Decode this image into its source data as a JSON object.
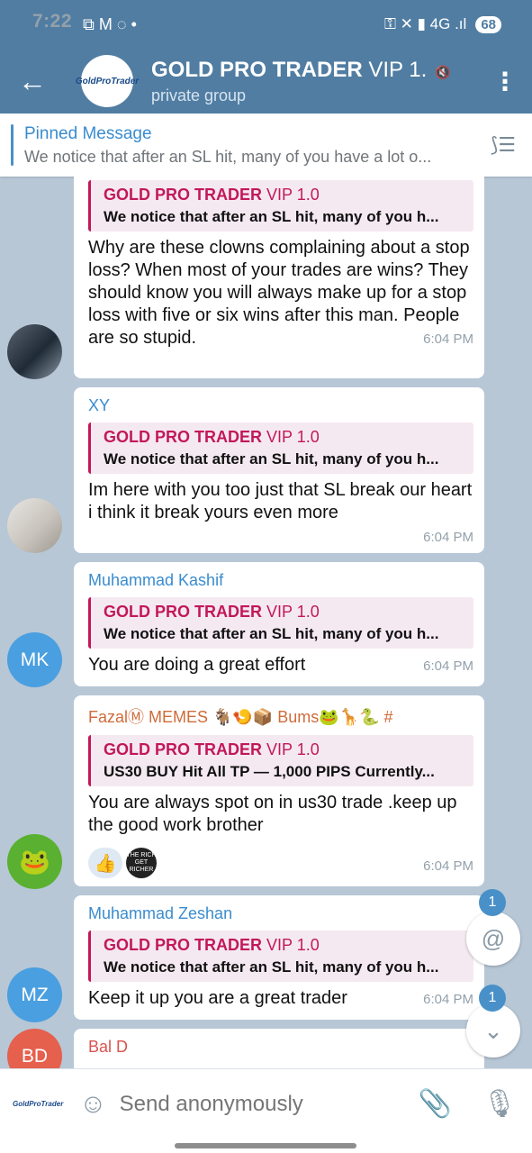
{
  "status": {
    "time": "7:22",
    "battery": "68",
    "left_icons": "⧉ M ◌ •",
    "right_icons": "⚿ ✕ ▮ 4G .ıl"
  },
  "header": {
    "title_bold": "GOLD PRO TRADER",
    "title_rest": " VIP 1.",
    "subtitle": "private group",
    "avatar_text": "GoldProTrader",
    "back_icon": "←",
    "menu_icon": "⋮"
  },
  "pinned": {
    "title": "Pinned Message",
    "body": "We notice that after an SL hit, many of you have a lot o..."
  },
  "messages": [
    {
      "author": "",
      "reply_title_bold": "GOLD PRO TRADER",
      "reply_title_rest": " VIP 1.0",
      "reply_body": "We notice that after an SL hit, many of you h...",
      "text": "Why are these clowns complaining about a stop loss? When most of your trades are wins? They should know you will always make up for a stop loss with five or six wins after this man. People are so stupid.",
      "time": "6:04 PM"
    },
    {
      "author": "XY",
      "author_color": "#3a8ccf",
      "reply_title_bold": "GOLD PRO TRADER",
      "reply_title_rest": " VIP 1.0",
      "reply_body": "We notice that after an SL hit, many of you h...",
      "text": "Im here with you too just that SL break our heart i think it break yours even more",
      "time": "6:04 PM"
    },
    {
      "author": "Muhammad Kashif",
      "author_color": "#3a8ccf",
      "avatar": "MK",
      "reply_title_bold": "GOLD PRO TRADER",
      "reply_title_rest": " VIP 1.0",
      "reply_body": "We notice that after an SL hit, many of you h...",
      "text": "You are doing a great effort",
      "time": "6:04 PM"
    },
    {
      "author": "FazalⓂ MEMES 🐐🍤📦 Bums🐸🦒🐍 #",
      "author_color": "#cf6b3a",
      "reply_title_bold": "GOLD PRO TRADER",
      "reply_title_rest": " VIP 1.0",
      "reply_body": "US30 BUY Hit All TP — 1,000 PIPS  Currently...",
      "text": "You are always spot on in us30 trade .keep up the good work brother",
      "reaction_1": "👍",
      "reaction_2": "THE RICH GET RICHER",
      "time": "6:04 PM"
    },
    {
      "author": "Muhammad Zeshan",
      "author_color": "#3a8ccf",
      "avatar": "MZ",
      "reply_title_bold": "GOLD PRO TRADER",
      "reply_title_rest": " VIP 1.0",
      "reply_body": "We notice that after an SL hit, many of you h...",
      "text": "Keep it up you are a great trader",
      "time": "6:04 PM"
    },
    {
      "author": "Bal D",
      "author_color": "#d9534f",
      "avatar": "BD"
    }
  ],
  "fabs": {
    "mention_badge": "1",
    "scroll_badge": "1",
    "mention_icon": "@",
    "scroll_icon": "⌄"
  },
  "input": {
    "placeholder": "Send anonymously",
    "send_as": "GoldProTrader"
  },
  "colors": {
    "header": "#517da2",
    "reply_accent": "#c2185b",
    "link": "#3a8ccf",
    "mk_avatar": "#4a9fe0",
    "mz_avatar": "#4a9fe0",
    "bd_avatar": "#e5604d"
  }
}
